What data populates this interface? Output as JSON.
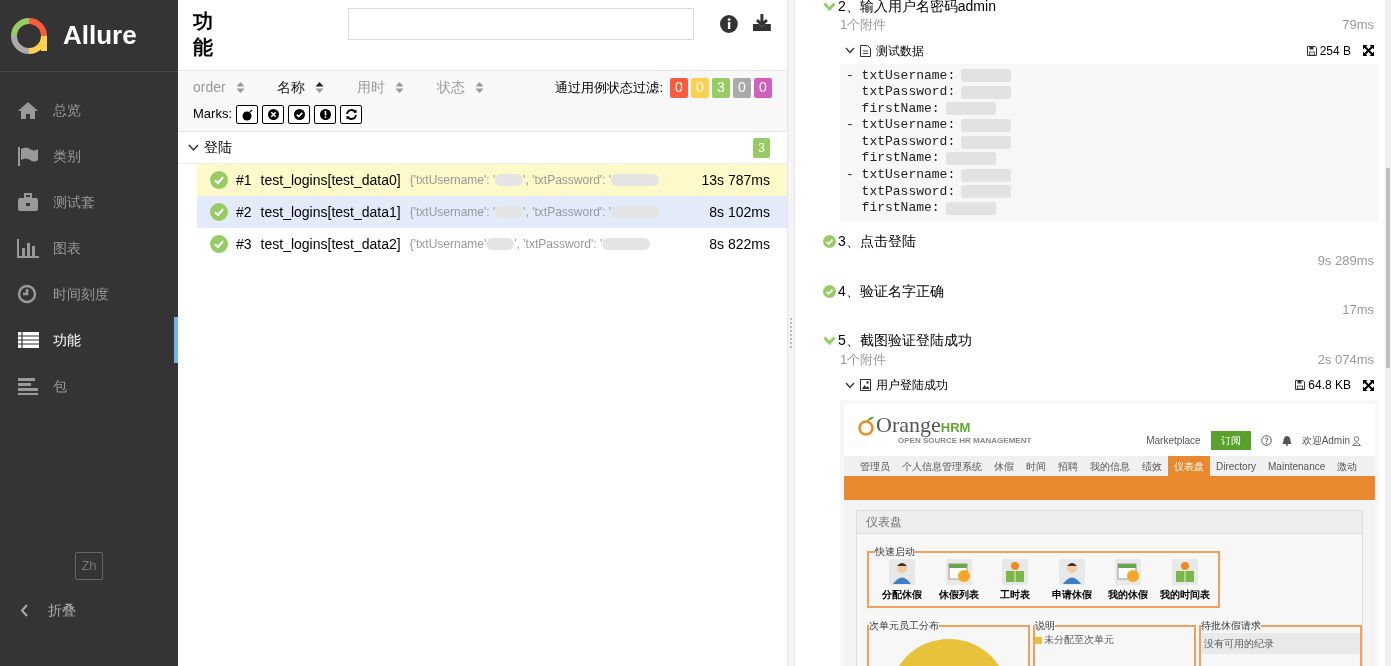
{
  "sidebar": {
    "logo_text": "Allure",
    "items": [
      {
        "label": "总览",
        "selected": false
      },
      {
        "label": "类别",
        "selected": false
      },
      {
        "label": "测试套",
        "selected": false
      },
      {
        "label": "图表",
        "selected": false
      },
      {
        "label": "时间刻度",
        "selected": false
      },
      {
        "label": "功能",
        "selected": true
      },
      {
        "label": "包",
        "selected": false
      }
    ],
    "language": "Zh",
    "collapse": "折叠"
  },
  "features": {
    "title": "功能",
    "sort_columns": [
      {
        "label": "order",
        "selected": false
      },
      {
        "label": "名称",
        "selected": true
      },
      {
        "label": "用时",
        "selected": false
      },
      {
        "label": "状态",
        "selected": false
      }
    ],
    "filter_label": "通过用例状态过滤:",
    "status_filters": [
      {
        "count": "0",
        "color": "#fd5a3e"
      },
      {
        "count": "0",
        "color": "#ffd050"
      },
      {
        "count": "3",
        "color": "#97cc64"
      },
      {
        "count": "0",
        "color": "#aaaaaa"
      },
      {
        "count": "0",
        "color": "#d35ebe"
      }
    ],
    "marks_label": "Marks:",
    "group": {
      "name": "登陆",
      "count": "3",
      "expanded": true,
      "rows": [
        {
          "number": "#1",
          "name": "test_logins[test_data0]",
          "params": [
            "{'txtUsername': '",
            "', 'txtPassword': '"
          ],
          "duration": "13s 787ms",
          "selected": true,
          "hovered": false
        },
        {
          "number": "#2",
          "name": "test_logins[test_data1]",
          "params": [
            "{'txtUsername': '",
            "', 'txtPassword': '"
          ],
          "duration": "8s 102ms",
          "selected": false,
          "hovered": true
        },
        {
          "number": "#3",
          "name": "test_logins[test_data2]",
          "params": [
            "{'txtUsername'",
            "', 'txtPassword': '"
          ],
          "duration": "8s 822ms",
          "selected": false,
          "hovered": false
        }
      ]
    }
  },
  "steps": [
    {
      "expanded": true,
      "title": "2、输入用户名密码admin",
      "attachments_count": "1个附件",
      "duration": "79ms",
      "attachment": {
        "kind": "text",
        "name": "测试数据",
        "size": "254 B",
        "lines": [
          "- txtUsername:",
          "  txtPassword:",
          "  firstName:",
          "- txtUsername:",
          "  txtPassword:",
          "  firstName:",
          "- txtUsername:",
          "  txtPassword:",
          "  firstName:"
        ]
      }
    },
    {
      "expanded": false,
      "title": "3、点击登陆",
      "duration": "9s 289ms"
    },
    {
      "expanded": false,
      "title": "4、验证名字正确",
      "duration": "17ms"
    },
    {
      "expanded": true,
      "title": "5、截图验证登陆成功",
      "attachments_count": "1个附件",
      "duration": "2s 074ms",
      "attachment": {
        "kind": "image",
        "name": "用户登陆成功",
        "size": "64.8 KB",
        "screenshot": {
          "logo_main": "Orange",
          "logo_accent": "HRM",
          "logo_tagline": "OPEN SOURCE HR MANAGEMENT",
          "marketplace": "Marketplace",
          "subscribe": "订阅",
          "welcome": "欢迎Admin",
          "nav": [
            {
              "label": "管理员",
              "selected": false
            },
            {
              "label": "个人信息管理系统",
              "selected": false
            },
            {
              "label": "休假",
              "selected": false
            },
            {
              "label": "时间",
              "selected": false
            },
            {
              "label": "招聘",
              "selected": false
            },
            {
              "label": "我的信息",
              "selected": false
            },
            {
              "label": "绩效",
              "selected": false
            },
            {
              "label": "仪表盘",
              "selected": true
            },
            {
              "label": "Directory",
              "selected": false
            },
            {
              "label": "Maintenance",
              "selected": false
            },
            {
              "label": "激动",
              "selected": false
            }
          ],
          "page_title": "仪表盘",
          "quick_launch_title": "快速启动",
          "quick_launch": [
            {
              "label": "分配休假",
              "kind": "person"
            },
            {
              "label": "休假列表",
              "kind": "calendar"
            },
            {
              "label": "工时表",
              "kind": "reader"
            },
            {
              "label": "申请休假",
              "kind": "person"
            },
            {
              "label": "我的休假",
              "kind": "calendar"
            },
            {
              "label": "我的时间表",
              "kind": "reader"
            }
          ],
          "panels": [
            {
              "title": "次单元员工分布",
              "kind": "pie"
            },
            {
              "title": "说明",
              "kind": "legend",
              "items": [
                {
                  "label": "未分配至次单元",
                  "color": "#e8c23a"
                }
              ]
            },
            {
              "title": "待批休假请求",
              "kind": "list",
              "items": [
                {
                  "label": "没有可用的纪录"
                }
              ]
            }
          ]
        }
      }
    }
  ]
}
